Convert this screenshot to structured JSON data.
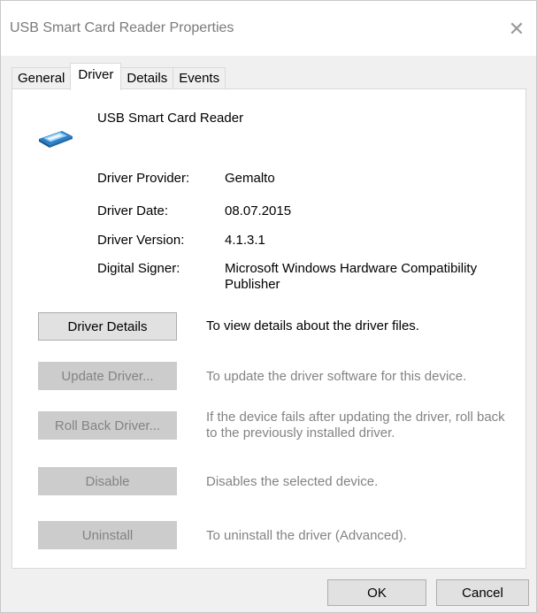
{
  "window": {
    "title": "USB Smart Card Reader Properties",
    "close_glyph": "✕"
  },
  "tabs": [
    {
      "label": "General",
      "active": false
    },
    {
      "label": "Driver",
      "active": true
    },
    {
      "label": "Details",
      "active": false
    },
    {
      "label": "Events",
      "active": false
    }
  ],
  "device": {
    "name": "USB Smart Card Reader",
    "icon": "smart-card-reader-icon"
  },
  "info": [
    {
      "label": "Driver Provider:",
      "value": "Gemalto"
    },
    {
      "label": "Driver Date:",
      "value": "08.07.2015"
    },
    {
      "label": "Driver Version:",
      "value": "4.1.3.1"
    },
    {
      "label": "Digital Signer:",
      "value": "Microsoft Windows Hardware Compatibility Publisher"
    }
  ],
  "actions": [
    {
      "label": "Driver Details",
      "description": "To view details about the driver files.",
      "enabled": true
    },
    {
      "label": "Update Driver...",
      "description": "To update the driver software for this device.",
      "enabled": false
    },
    {
      "label": "Roll Back Driver...",
      "description": "If the device fails after updating the driver, roll back to the previously installed driver.",
      "enabled": false
    },
    {
      "label": "Disable",
      "description": "Disables the selected device.",
      "enabled": false
    },
    {
      "label": "Uninstall",
      "description": "To uninstall the driver (Advanced).",
      "enabled": false
    }
  ],
  "footer": {
    "ok_label": "OK",
    "cancel_label": "Cancel"
  },
  "colors": {
    "disabled_text": "#838383",
    "button_face": "#e1e1e1",
    "disabled_button_face": "#cccccc"
  }
}
